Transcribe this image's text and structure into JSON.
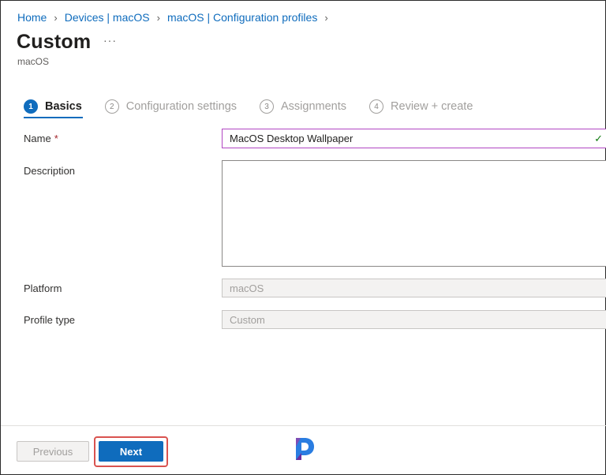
{
  "breadcrumb": [
    "Home",
    "Devices | macOS",
    "macOS | Configuration profiles"
  ],
  "header": {
    "title": "Custom",
    "more": "···",
    "subtitle": "macOS"
  },
  "steps": [
    {
      "num": "1",
      "label": "Basics",
      "active": true
    },
    {
      "num": "2",
      "label": "Configuration settings"
    },
    {
      "num": "3",
      "label": "Assignments"
    },
    {
      "num": "4",
      "label": "Review + create"
    }
  ],
  "form": {
    "name_label": "Name",
    "required_mark": "*",
    "name_value": "MacOS Desktop Wallpaper",
    "description_label": "Description",
    "description_value": "",
    "platform_label": "Platform",
    "platform_value": "macOS",
    "profile_type_label": "Profile type",
    "profile_type_value": "Custom"
  },
  "footer": {
    "previous_label": "Previous",
    "next_label": "Next"
  },
  "colors": {
    "accent": "#0f6cbd",
    "highlight": "#d9534f",
    "valid": "#107c10"
  },
  "icons": {
    "validation": "check-icon",
    "watermark": "prajwal-logo-icon"
  }
}
